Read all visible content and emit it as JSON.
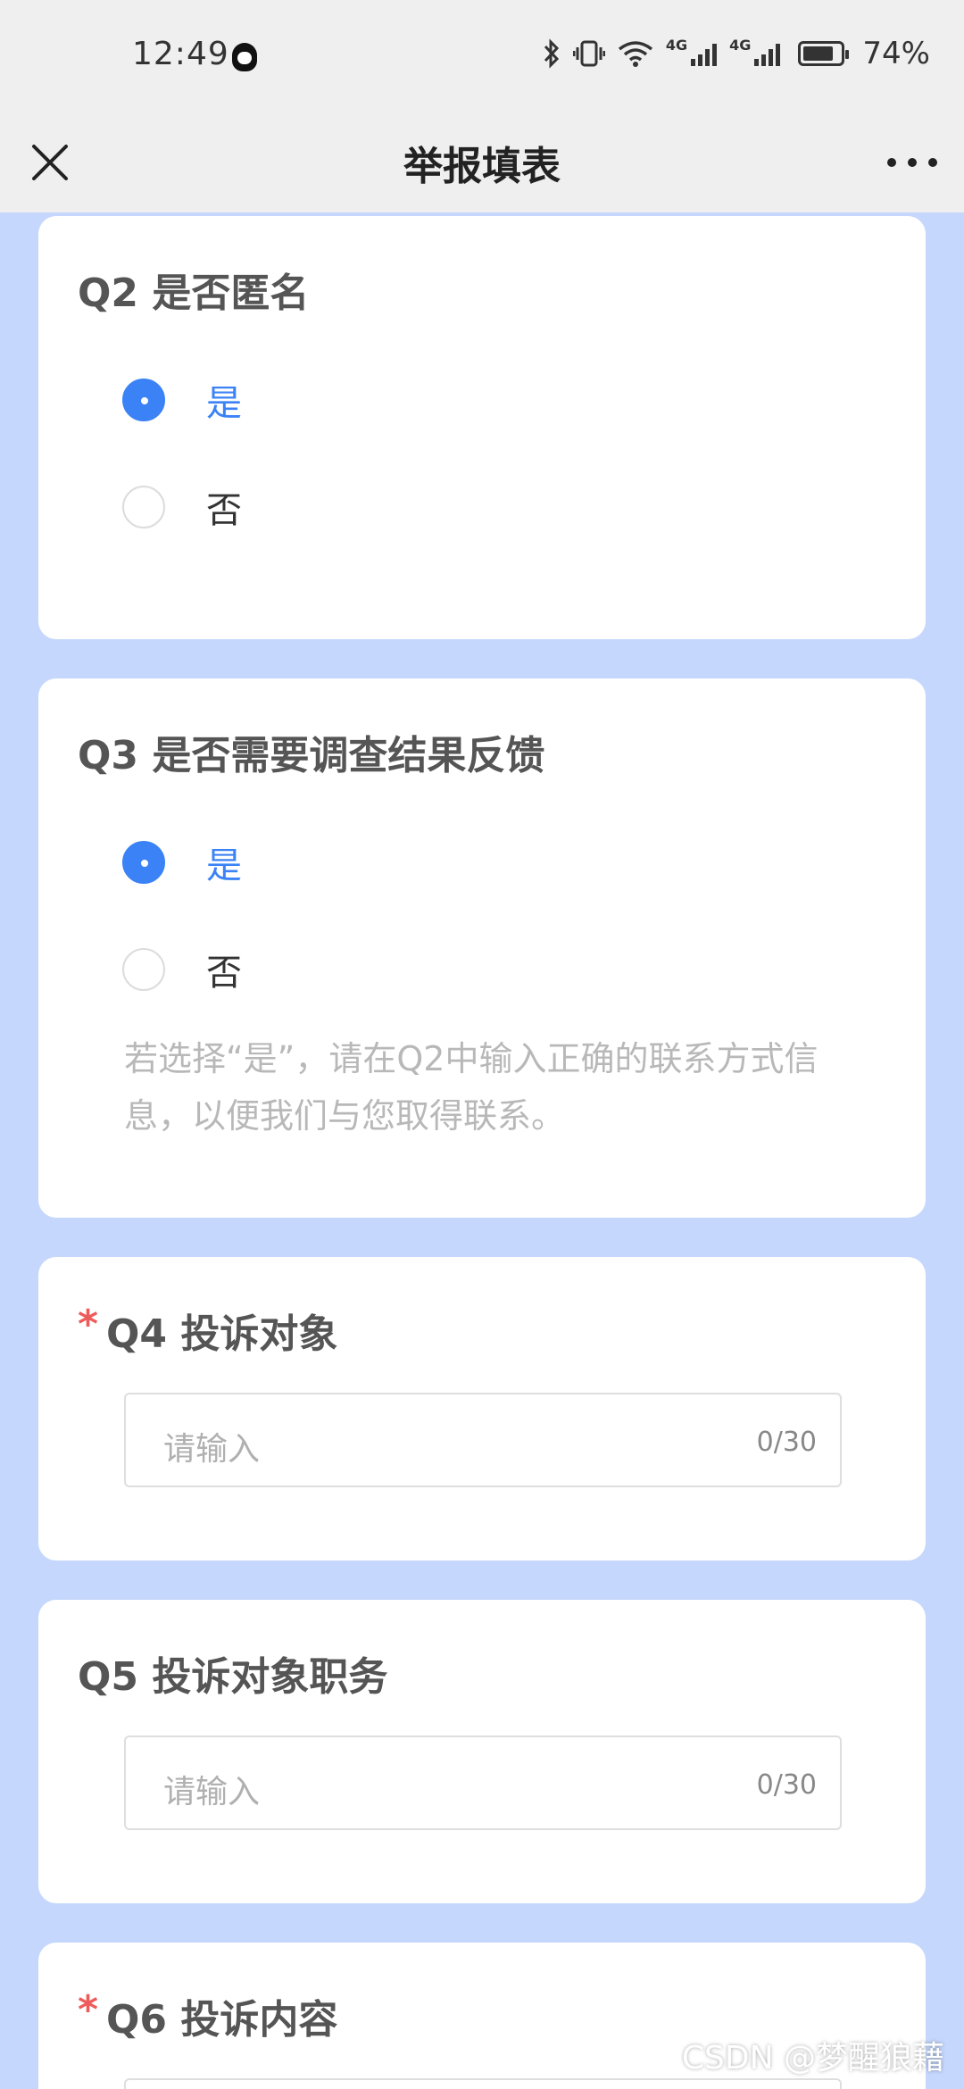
{
  "status_bar": {
    "time": "12:49",
    "network_1": "4G",
    "network_2": "4G",
    "battery": "74%",
    "icons": [
      "qq-icon",
      "bluetooth-icon",
      "vibrate-icon",
      "wifi-icon",
      "signal-icon",
      "signal-icon",
      "battery-icon"
    ]
  },
  "nav": {
    "title": "举报填表",
    "close_icon": "close-icon",
    "more_icon": "more-icon"
  },
  "questions": {
    "q2": {
      "title": "Q2 是否匿名",
      "options": [
        {
          "label": "是",
          "selected": true
        },
        {
          "label": "否",
          "selected": false
        }
      ]
    },
    "q3": {
      "title": "Q3 是否需要调查结果反馈",
      "options": [
        {
          "label": "是",
          "selected": true
        },
        {
          "label": "否",
          "selected": false
        }
      ],
      "hint": "若选择“是”，请在Q2中输入正确的联系方式信息，以便我们与您取得联系。"
    },
    "q4": {
      "required_mark": "*",
      "title": "Q4 投诉对象",
      "placeholder": "请输入",
      "counter": "0/30"
    },
    "q5": {
      "title": "Q5 投诉对象职务",
      "placeholder": "请输入",
      "counter": "0/30"
    },
    "q6": {
      "required_mark": "*",
      "title": "Q6 投诉内容"
    }
  },
  "watermark": "CSDN @梦醒狼藉",
  "colors": {
    "accent": "#3b82f6",
    "background": "#c5d7fc",
    "required": "#ee5b5b"
  }
}
